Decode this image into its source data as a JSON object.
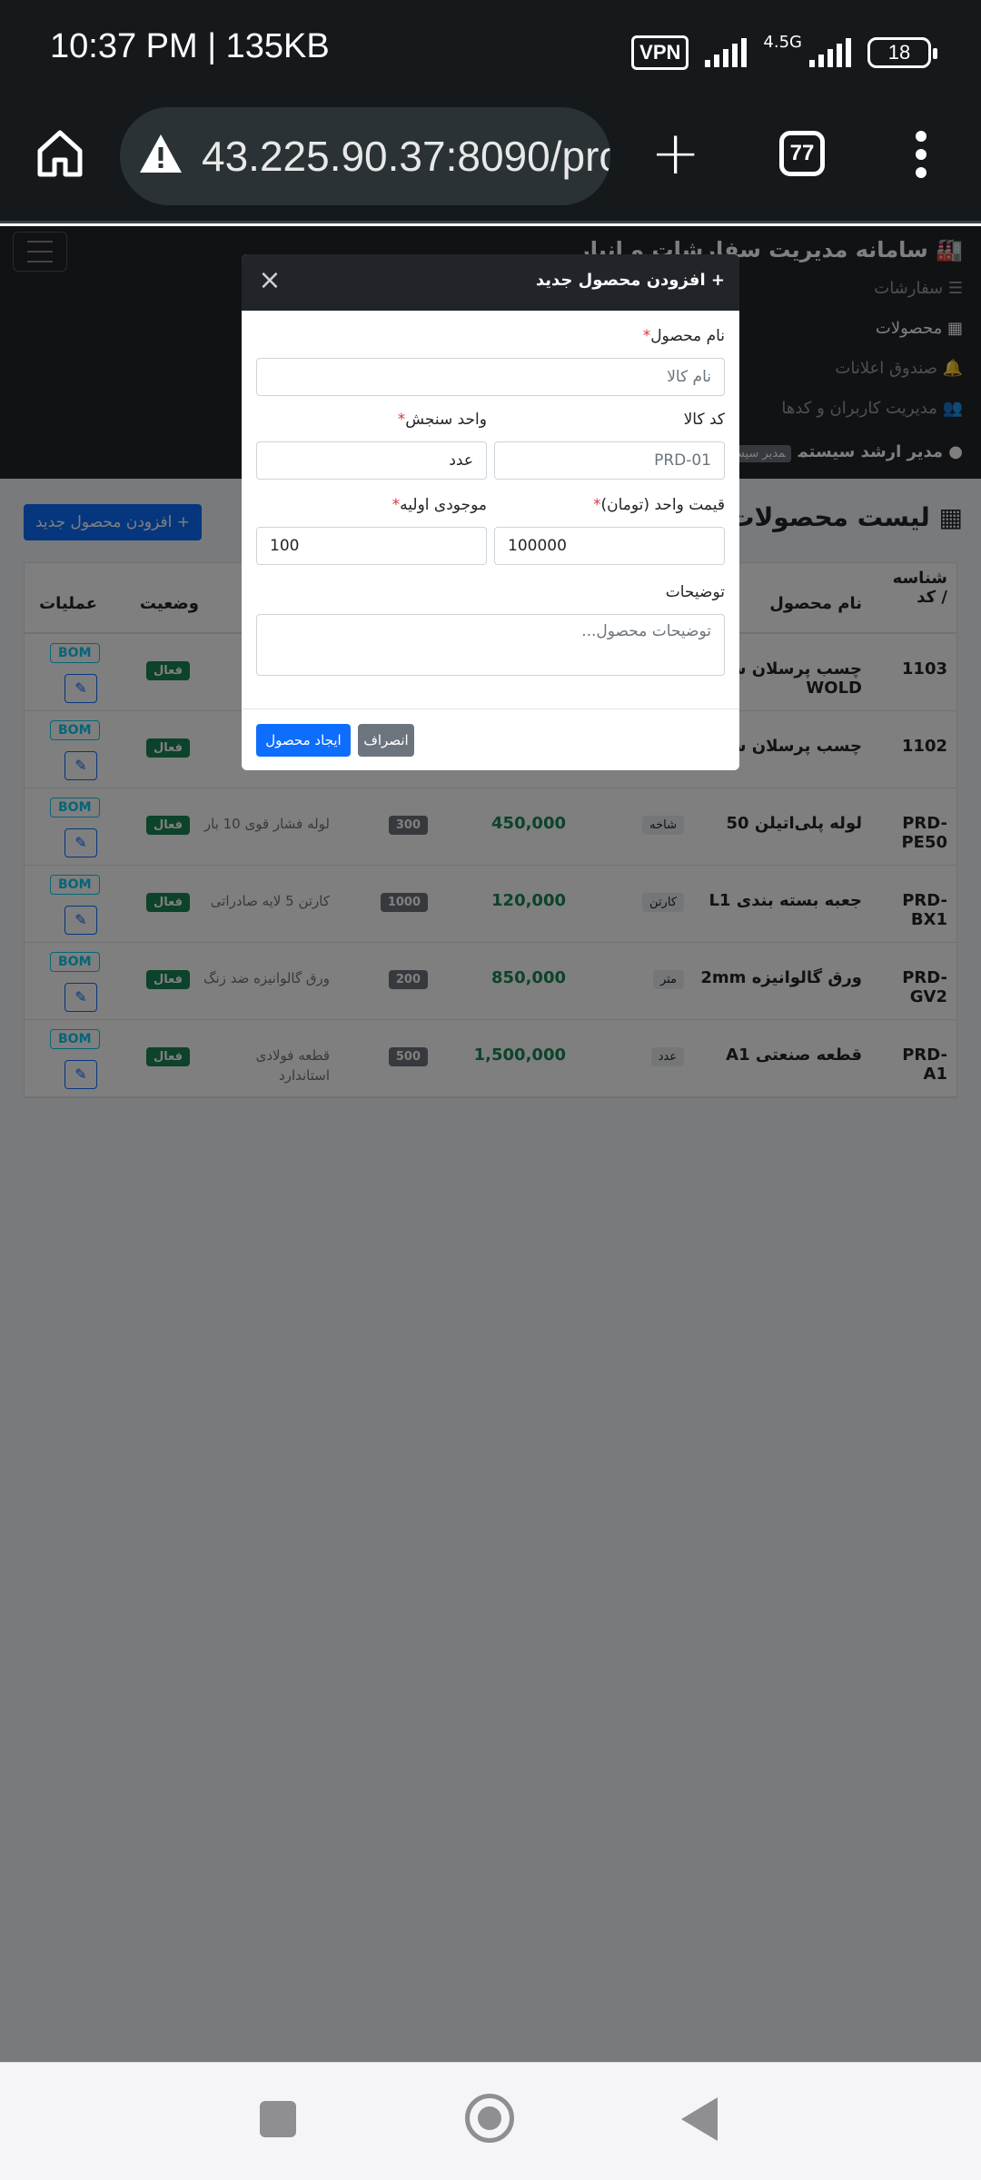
{
  "status_bar": {
    "time": "10:37 PM | 135KB",
    "vpn": "VPN",
    "network": "4.5G",
    "battery": "18"
  },
  "browser": {
    "url": "43.225.90.37:8090/pro",
    "tab_count": "77"
  },
  "app_nav": {
    "brand": "سامانه مدیریت سفارشات و انبار",
    "items": [
      {
        "label": "سفارشات"
      },
      {
        "label": "محصولات"
      },
      {
        "label": "صندوق اعلانات"
      },
      {
        "label": "مدیریت کاربران و کدها"
      }
    ],
    "user": "مدیر ارشد سیستم",
    "role": "مدیر سیستم (ا"
  },
  "page": {
    "title": "لیست محصولات و کالاها",
    "add_button": "افزودن محصول جدید",
    "table": {
      "headers": {
        "code": "شناسه / کد",
        "name": "نام محصول",
        "status": "وضعیت",
        "actions": "عملیات"
      },
      "rows": [
        {
          "code": "1103",
          "name": "چسب پرسلان سفید WOLD",
          "unit": "",
          "price": "",
          "stock": "",
          "desc": "",
          "status": "فعال",
          "bom": "BOM"
        },
        {
          "code": "1102",
          "name": "چسب پرسلان سفید",
          "unit": "",
          "price": "",
          "stock": "",
          "desc": "",
          "status": "فعال",
          "bom": "BOM"
        },
        {
          "code": "PRD-PE50",
          "name": "لوله پلی‌اتیلن 50",
          "unit": "شاخه",
          "price": "450,000",
          "stock": "300",
          "desc": "لوله فشار قوی 10 بار",
          "status": "فعال",
          "bom": "BOM"
        },
        {
          "code": "PRD-BX1",
          "name": "جعبه بسته بندی L1",
          "unit": "کارتن",
          "price": "120,000",
          "stock": "1000",
          "desc": "کارتن 5 لایه صادراتی",
          "status": "فعال",
          "bom": "BOM"
        },
        {
          "code": "PRD-GV2",
          "name": "ورق گالوانیزه 2mm",
          "unit": "متر",
          "price": "850,000",
          "stock": "200",
          "desc": "ورق گالوانیزه ضد زنگ",
          "status": "فعال",
          "bom": "BOM"
        },
        {
          "code": "PRD-A1",
          "name": "قطعه صنعتی A1",
          "unit": "عدد",
          "price": "1,500,000",
          "stock": "500",
          "desc": "قطعه فولادی استاندارد",
          "status": "فعال",
          "bom": "BOM"
        }
      ]
    }
  },
  "modal": {
    "title": "افزودن محصول جدید",
    "fields": {
      "name_label": "نام محصول",
      "name_placeholder": "نام کالا",
      "code_label": "کد کالا",
      "code_placeholder": "PRD-01",
      "unit_label": "واحد سنجش",
      "unit_value": "عدد",
      "price_label": "قیمت واحد (تومان)",
      "price_value": "100000",
      "stock_label": "موجودی اولیه",
      "stock_value": "100",
      "desc_label": "توضیحات",
      "desc_placeholder": "توضیحات محصول..."
    },
    "submit": "ایجاد محصول",
    "cancel": "انصراف"
  },
  "colors": {
    "primary": "#0d6efd",
    "success": "#198754",
    "dark": "#212529",
    "danger": "#dc3545",
    "info": "#0dcaf0"
  }
}
